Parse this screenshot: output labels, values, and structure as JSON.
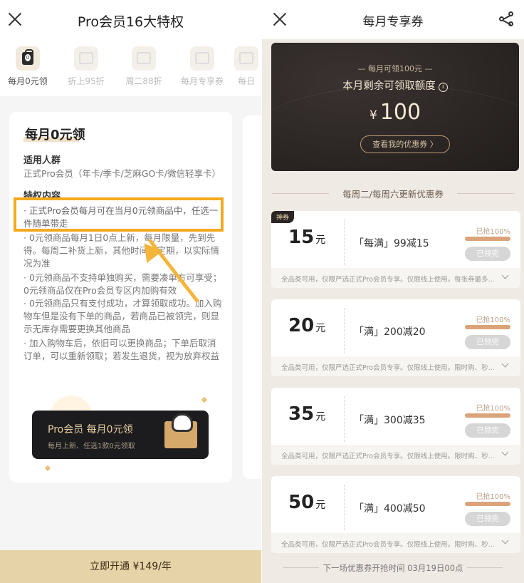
{
  "left": {
    "title": "Pro会员16大特权",
    "tabs": [
      {
        "label": "每月0元领",
        "active": true
      },
      {
        "label": "折上95折"
      },
      {
        "label": "周二88折"
      },
      {
        "label": "每月专享券"
      },
      {
        "label": "每日"
      }
    ],
    "card": {
      "title": "每月0元领",
      "audience_title": "适用人群",
      "audience_text": "正式Pro会员（年卡/季卡/芝麻GO卡/微信轻享卡）",
      "content_title": "特权内容",
      "highlight_text": "· 正式Pro会员每月可在当月0元领商品中，任选一件随单带走",
      "rules": [
        "· 0元领商品每月1日0点上新，每月限量，先到先得。每周二补货上新，其他时间不定期，以实际情况为准",
        "· 0元领商品不支持单独购买，需要凑单方可享受；0元领商品仅在Pro会员专区内加购有效",
        "· 0元领商品只有支付成功，才算领取成功。加入购物车但是没有下单的商品，若商品已被领完，则显示无库存需要更换其他商品",
        "· 加入购物车后，依旧可以更换商品；下单后取消订单，可以重新领取；若发生退货，视为放弃权益"
      ],
      "promo_title": "Pro会员 每月0元领",
      "promo_sub": "每月上新、任选1款0元领取"
    },
    "cta": "立即开通 ¥149/年"
  },
  "right": {
    "title": "每月专享券",
    "hero": {
      "small": "— 每月可领100元 —",
      "label": "本月剩余可领取额度",
      "currency": "¥",
      "amount": "100",
      "button": "查看我的优惠券 〉"
    },
    "section_title": "每周二/每周六更新优惠券",
    "coupons": [
      {
        "tag": "神券",
        "amount": "15",
        "unit": "元",
        "condition": "「每满」99减15",
        "claimed_pct": "已抢100%",
        "claimed_fraction": 1.0,
        "status": "已领完",
        "footnote": "全品类可用，仅限严选正式Pro会员专享。仅限线上使用。每张券最多..."
      },
      {
        "tag": "",
        "amount": "20",
        "unit": "元",
        "condition": "「满」200减20",
        "claimed_pct": "已抢100%",
        "claimed_fraction": 1.0,
        "status": "已领完",
        "footnote": "全品类可用，仅限严选正式Pro会员专享。仅限线上使用。限时购、秒..."
      },
      {
        "tag": "",
        "amount": "35",
        "unit": "元",
        "condition": "「满」300减35",
        "claimed_pct": "已抢100%",
        "claimed_fraction": 1.0,
        "status": "已领完",
        "footnote": "全品类可用，仅限严选正式Pro会员专享。仅限线上使用。限时购、秒..."
      },
      {
        "tag": "",
        "amount": "50",
        "unit": "元",
        "condition": "「满」400减50",
        "claimed_pct": "已抢100%",
        "claimed_fraction": 1.0,
        "status": "已领完",
        "footnote": "全品类可用，仅限严选正式Pro会员专享。仅限线上使用。限时购、秒..."
      }
    ],
    "next_time": "下一场优惠券开抢时间 03月19日00点"
  },
  "colors": {
    "accent_gold": "#e7d3a8",
    "highlight": "#f5a91e",
    "dark_card": "#2b2624",
    "bar_fill": "#dba37a"
  }
}
